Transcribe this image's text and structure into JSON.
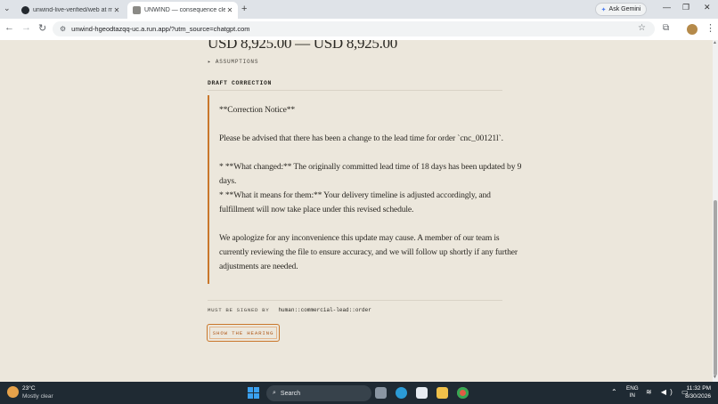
{
  "browser": {
    "tabs": [
      {
        "title": "unwind-live-verified/web at ma",
        "close": "✕"
      },
      {
        "title": "UNWIND — consequence clear",
        "close": "✕"
      }
    ],
    "new_tab": "+",
    "tab_menu": "⌄",
    "gemini_label": "Ask Gemini",
    "window_controls": {
      "minimize": "—",
      "restore": "❐",
      "close": "✕"
    },
    "nav": {
      "back": "←",
      "forward": "→",
      "reload": "↻"
    },
    "url": "unwind-hgeodtazqq-uc.a.run.app/?utm_source=chatgpt.com",
    "icons": {
      "star": "☆",
      "extensions": "⧉",
      "menu": "⋮",
      "tune": "⚙"
    }
  },
  "page": {
    "price_range": "USD 8,925.00 — USD 8,925.00",
    "assumptions_label": "ASSUMPTIONS",
    "assumptions_toggle": "▸",
    "draft_heading": "DRAFT CORRECTION",
    "draft_lines": [
      "**Correction Notice**",
      "Please be advised that there has been a change to the lead time for order `cnc_00121l`.",
      "* **What changed:** The originally committed lead time of 18 days has been updated by 9",
      "days.",
      "* **What it means for them:** Your delivery timeline is adjusted accordingly, and",
      "fulfillment will now take place under this revised schedule.",
      "We apologize for any inconvenience this update may cause. A member of our team is",
      "currently reviewing the file to ensure accuracy, and we will follow up shortly if any further",
      "adjustments are needed."
    ],
    "signed_label": "MUST BE SIGNED BY",
    "signed_value": "human::commercial-lead::order",
    "show_button": "SHOW THE HEARING"
  },
  "taskbar": {
    "weather_temp": "23°C",
    "weather_cond": "Mostly clear",
    "search_label": "Search",
    "search_icon": "⌕",
    "tray_chevron": "⌃",
    "lang_line1": "ENG",
    "lang_line2": "IN",
    "sys_icons": "≋ ◀) ▭",
    "time": "11:32 PM",
    "date": "8/30/2026"
  },
  "colors": {
    "accent": "#c9772b",
    "page_bg": "#ece7dc",
    "text": "#2a2823"
  }
}
